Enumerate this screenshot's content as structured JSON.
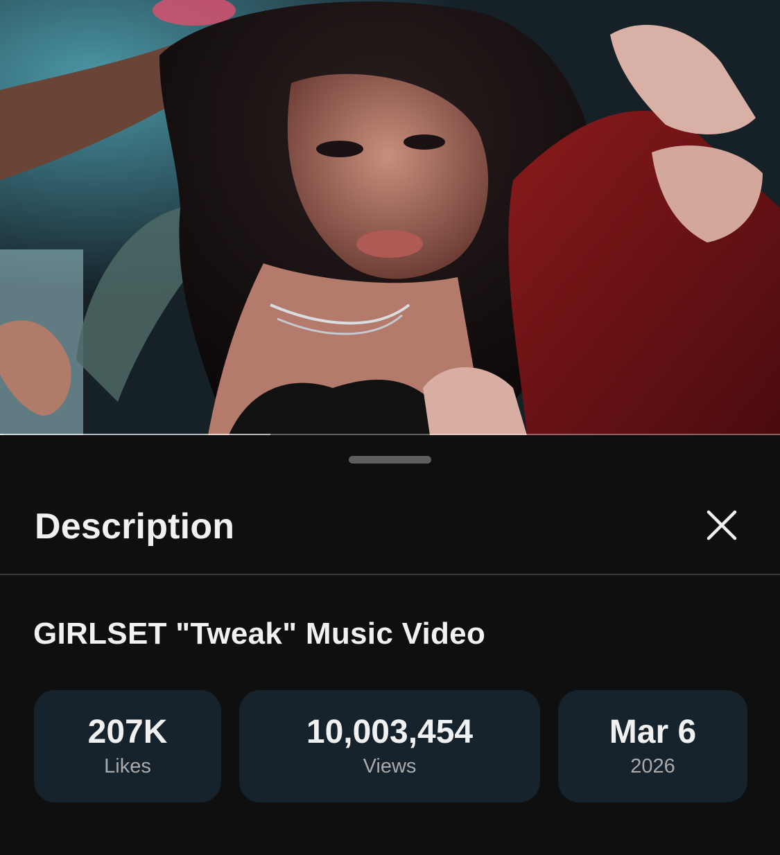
{
  "player": {
    "progress_fraction": 0.004,
    "buffer_fraction": 0.347,
    "frame_description_icon": "video-frame"
  },
  "sheet": {
    "title": "Description",
    "close_icon": "close-icon"
  },
  "video": {
    "title": "GIRLSET \"Tweak\" Music Video"
  },
  "stats": [
    {
      "value": "207K",
      "label": "Likes"
    },
    {
      "value": "10,003,454",
      "label": "Views"
    },
    {
      "value": "Mar 6",
      "label": "2026"
    }
  ],
  "colors": {
    "sheet_bg": "#0f0f0f",
    "stat_card_bg": "#16232c",
    "text_primary": "#f1f1f1",
    "text_secondary": "#aaaaaa",
    "divider": "#3a3a3a"
  }
}
